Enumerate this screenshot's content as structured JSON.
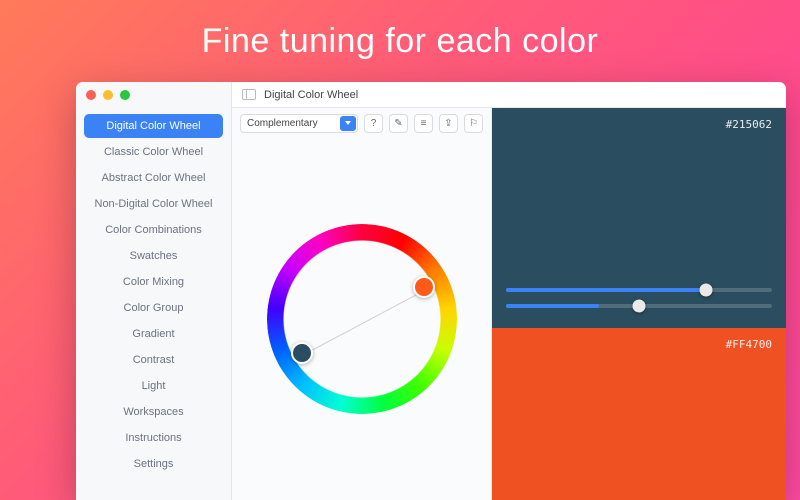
{
  "promo_title": "Fine tuning for each color",
  "window_title": "Digital Color Wheel",
  "sidebar": {
    "items": [
      {
        "label": "Digital Color Wheel",
        "active": true
      },
      {
        "label": "Classic Color Wheel",
        "active": false
      },
      {
        "label": "Abstract Color Wheel",
        "active": false
      },
      {
        "label": "Non-Digital Color Wheel",
        "active": false
      },
      {
        "label": "Color Combinations",
        "active": false
      },
      {
        "label": "Swatches",
        "active": false
      },
      {
        "label": "Color Mixing",
        "active": false
      },
      {
        "label": "Color Group",
        "active": false
      },
      {
        "label": "Gradient",
        "active": false
      },
      {
        "label": "Contrast",
        "active": false
      },
      {
        "label": "Light",
        "active": false
      },
      {
        "label": "Workspaces",
        "active": false
      },
      {
        "label": "Instructions",
        "active": false
      },
      {
        "label": "Settings",
        "active": false
      }
    ]
  },
  "toolbar": {
    "harmony_selected": "Complementary",
    "buttons": {
      "help": "?",
      "picker": "✎",
      "list": "≡",
      "export": "⇪",
      "bookmark": "⚐"
    }
  },
  "swatches": {
    "top": {
      "hex": "#215062",
      "color": "#2a4d5f"
    },
    "bottom": {
      "hex": "#FF4700",
      "color": "#ef5123"
    }
  },
  "sliders": {
    "s1": {
      "fill_pct": 75,
      "thumb_pct": 75
    },
    "s2": {
      "fill_pct": 35,
      "thumb_pct": 50
    }
  }
}
